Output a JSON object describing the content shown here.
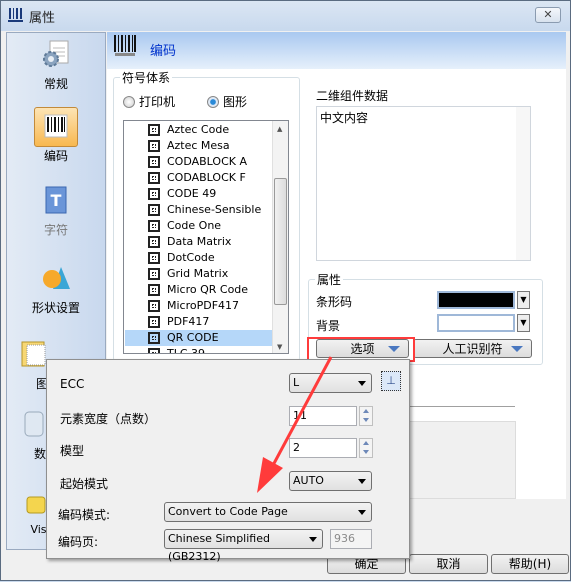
{
  "window": {
    "title": "属性",
    "close": "✕"
  },
  "sidebar": {
    "items": [
      {
        "label": "常规",
        "icon": "settings-document-icon"
      },
      {
        "label": "编码",
        "icon": "barcode-icon",
        "selected": true
      },
      {
        "label": "字符",
        "icon": "text-document-icon"
      },
      {
        "label": "形状设置",
        "icon": "shapes-icon"
      },
      {
        "label": "图",
        "icon": "picture-frame-icon"
      },
      {
        "label": "数",
        "icon": "database-icon"
      },
      {
        "label": "Visu",
        "icon": "visual-basic-icon"
      }
    ]
  },
  "header": {
    "title": "编码"
  },
  "symbology": {
    "group_label": "符号体系",
    "radio_printer": "打印机",
    "radio_graphic": "图形",
    "selected": "图形",
    "items": [
      "Aztec Code",
      "Aztec Mesa",
      "CODABLOCK A",
      "CODABLOCK F",
      "CODE 49",
      "Chinese-Sensible",
      "Code One",
      "Data Matrix",
      "DotCode",
      "Grid Matrix",
      "Micro QR Code",
      "MicroPDF417",
      "PDF417",
      "QR CODE",
      "TLC 39"
    ],
    "selected_item": "QR CODE"
  },
  "data2d": {
    "label": "二维组件数据",
    "value": "中文内容"
  },
  "properties": {
    "group_label": "属性",
    "barcode_label": "条形码",
    "barcode_color": "#000000",
    "background_label": "背景",
    "background_color": "#ffffff",
    "options_button": "选项",
    "hri_button": "人工识别符"
  },
  "options_popup": {
    "ecc_label": "ECC",
    "ecc_value": "L",
    "element_width_label": "元素宽度（点数）",
    "element_width_value": "11",
    "model_label": "模型",
    "model_value": "2",
    "start_mode_label": "起始模式",
    "start_mode_value": "AUTO",
    "encoding_mode_label": "编码模式:",
    "encoding_mode_value": "Convert to Code Page",
    "code_page_label": "编码页:",
    "code_page_value": "Chinese Simplified (GB2312)",
    "code_page_number": "936"
  },
  "footer": {
    "ok": "确定",
    "cancel": "取消",
    "help": "帮助(H)"
  },
  "colors": {
    "annotation": "#ff3b3b",
    "selection": "#b5d7f9",
    "header_text": "#0033cc"
  }
}
